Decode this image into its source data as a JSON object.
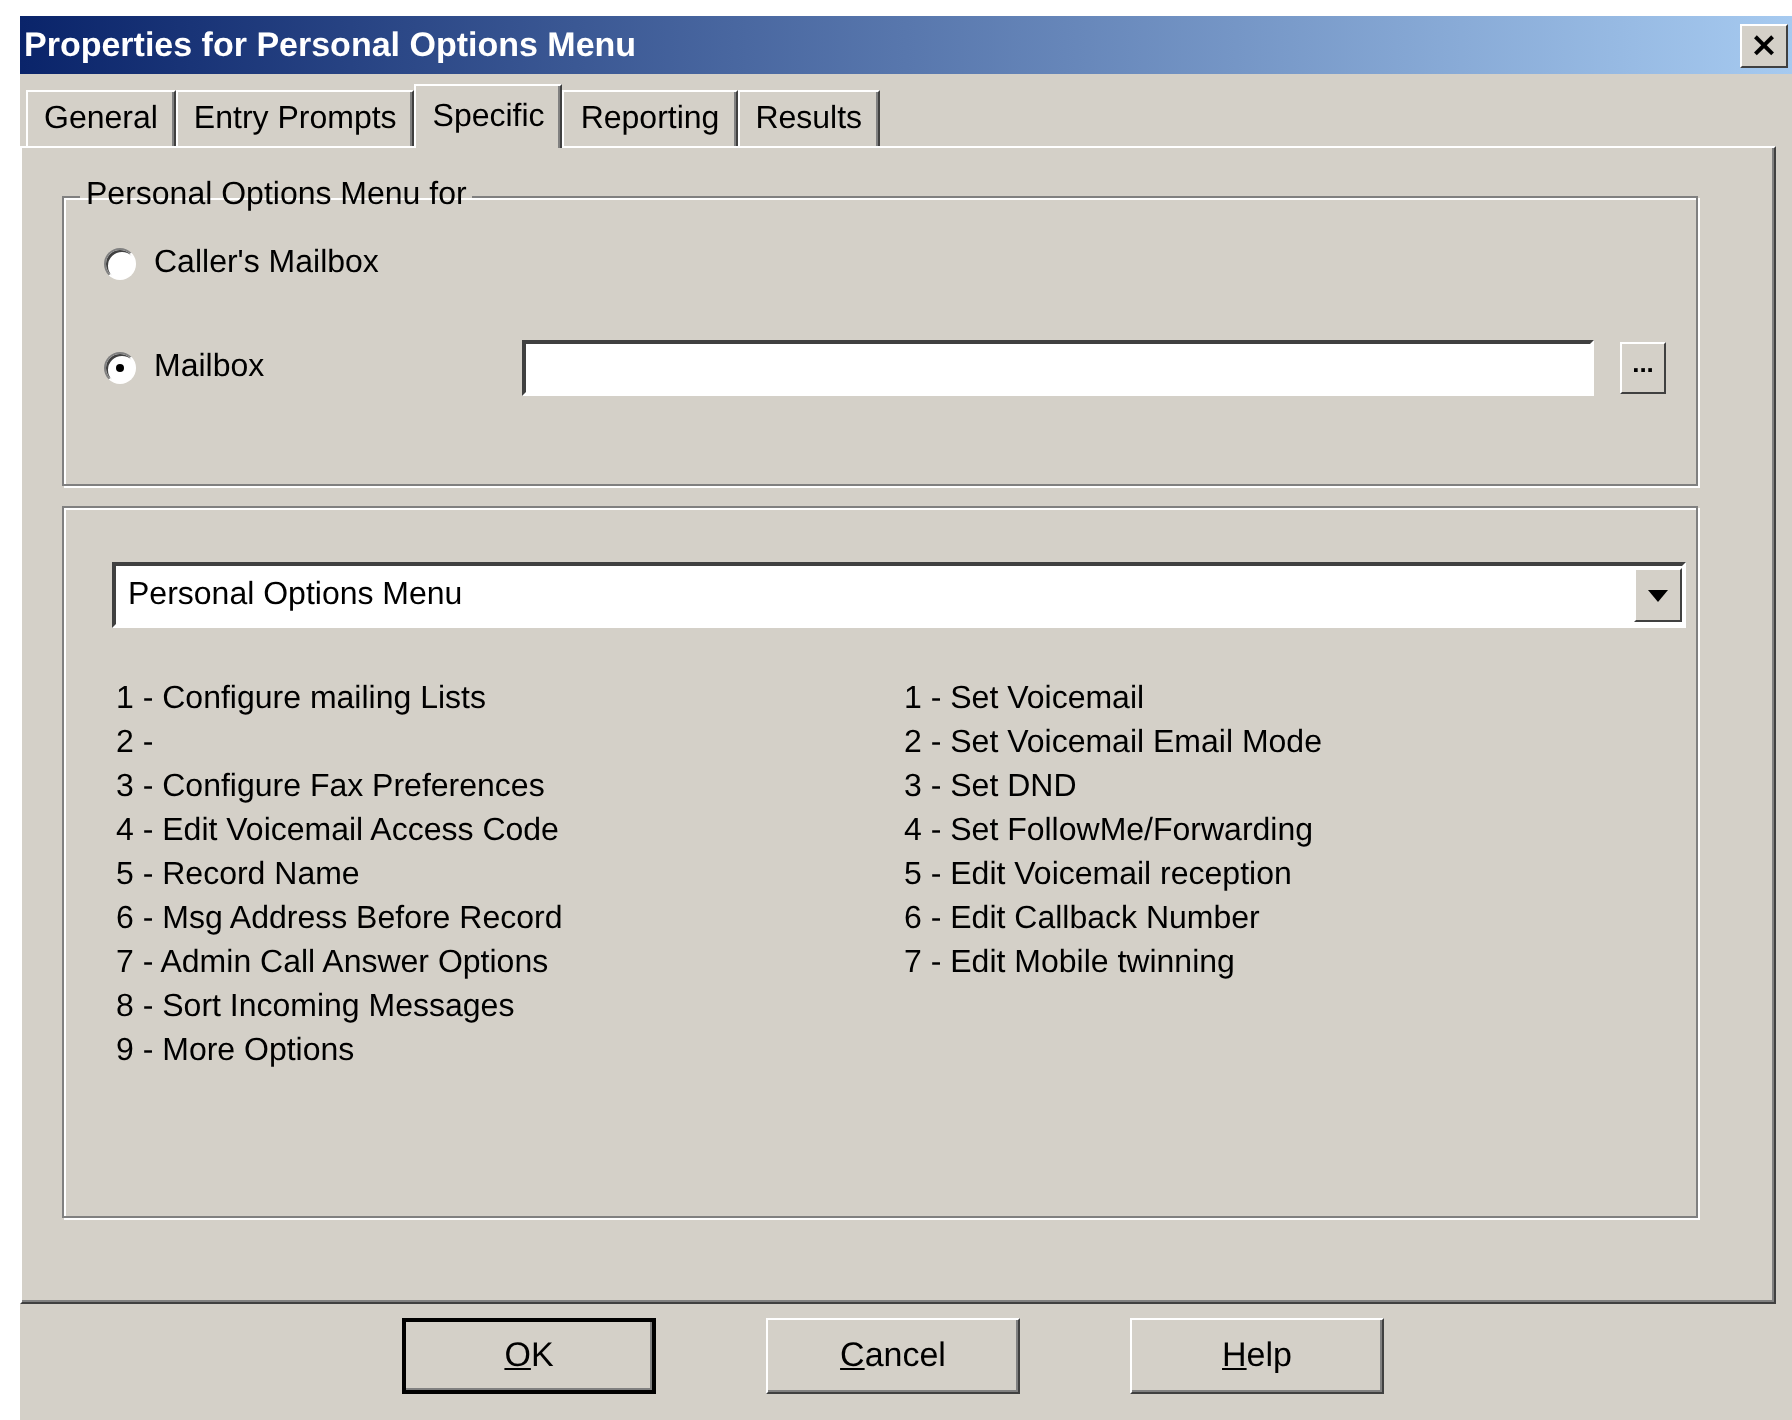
{
  "window": {
    "title": "Properties for Personal Options Menu",
    "close": "×"
  },
  "tabs": [
    {
      "label": "General",
      "selected": false
    },
    {
      "label": "Entry Prompts",
      "selected": false
    },
    {
      "label": "Specific",
      "selected": true
    },
    {
      "label": "Reporting",
      "selected": false
    },
    {
      "label": "Results",
      "selected": false
    }
  ],
  "group": {
    "title": "Personal Options Menu for",
    "options": [
      {
        "label": "Caller's Mailbox",
        "selected": false
      },
      {
        "label": "Mailbox",
        "selected": true
      }
    ],
    "browse": "..."
  },
  "menu": {
    "dropdown": "Personal Options Menu",
    "column_1": [
      "1 - Configure mailing Lists",
      "2 -",
      "3 - Configure Fax Preferences",
      "4 - Edit Voicemail Access Code",
      "5 - Record Name",
      "6 - Msg Address Before Record",
      "7 - Admin Call Answer Options",
      "8 - Sort Incoming Messages",
      "9 - More Options"
    ],
    "column_2": [
      "1 - Set Voicemail",
      "2 - Set Voicemail Email Mode",
      "3 - Set DND",
      "4 - Set FollowMe/Forwarding",
      "5 - Edit Voicemail reception",
      "6 - Edit Callback Number",
      "7 - Edit Mobile twinning"
    ]
  },
  "buttons": [
    {
      "accel": "O",
      "rest": "K",
      "default": true
    },
    {
      "accel": "C",
      "rest": "ancel",
      "default": false
    },
    {
      "accel": "H",
      "rest": "elp",
      "default": false
    }
  ]
}
